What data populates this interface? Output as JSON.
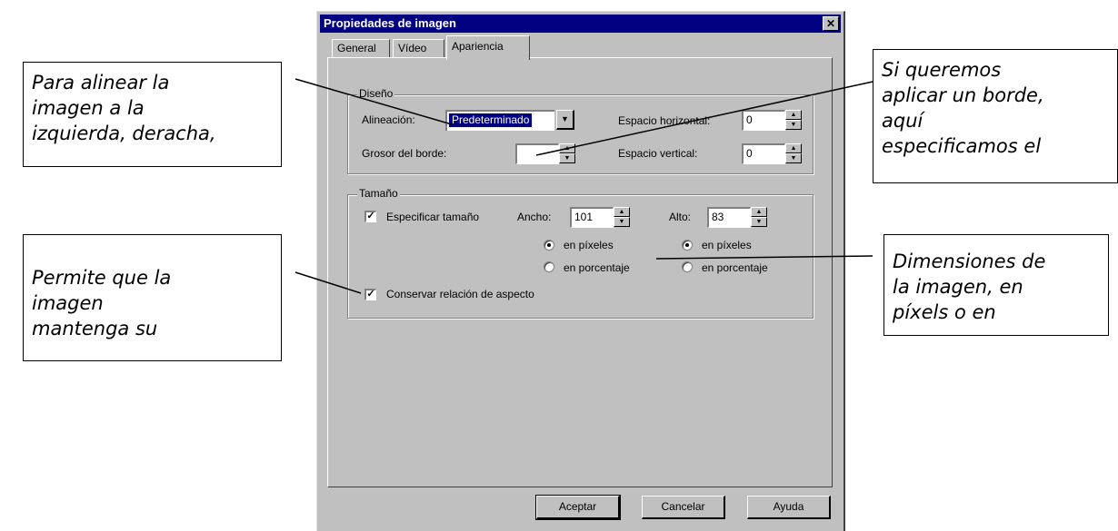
{
  "dialog": {
    "title": "Propiedades de imagen",
    "close_glyph": "✕",
    "tabs": [
      "General",
      "Vídeo",
      "Apariencia"
    ],
    "active_tab": "Apariencia",
    "design_group": {
      "label": "Diseño",
      "alignment_label": "Alineación:",
      "alignment_value": "Predeterminado",
      "border_width_label": "Grosor del borde:",
      "border_width_value": "",
      "horizontal_spacing_label": "Espacio horizontal:",
      "horizontal_spacing_value": "0",
      "vertical_spacing_label": "Espacio vertical:",
      "vertical_spacing_value": "0"
    },
    "size_group": {
      "label": "Tamaño",
      "specify_size_label": "Especificar tamaño",
      "specify_size_checked": true,
      "width_label": "Ancho:",
      "width_value": "101",
      "height_label": "Alto:",
      "height_value": "83",
      "pixels_label": "en píxeles",
      "percent_label": "en porcentaje",
      "width_unit": "en píxeles",
      "height_unit": "en píxeles",
      "keep_aspect_label": "Conservar relación de aspecto",
      "keep_aspect_checked": true
    },
    "buttons": {
      "ok": "Aceptar",
      "cancel": "Cancelar",
      "help": "Ayuda"
    }
  },
  "callouts": {
    "alignment": [
      "Para alinear la",
      "imagen a la",
      "izquierda, deracha,"
    ],
    "border": [
      "Si queremos",
      "aplicar un borde,",
      "aquí",
      "especificamos el"
    ],
    "aspect": [
      "Permite que la",
      "imagen",
      "mantenga su"
    ],
    "dimensions": [
      "Dimensiones de",
      "la imagen, en",
      "píxels o en"
    ]
  }
}
